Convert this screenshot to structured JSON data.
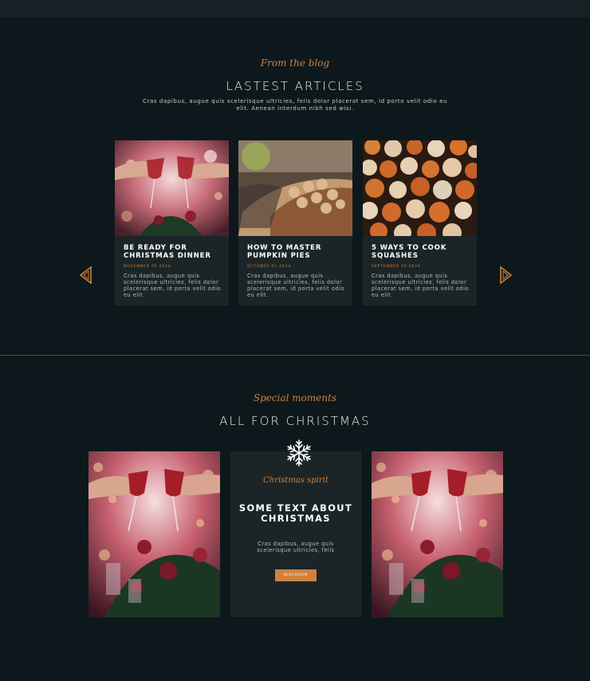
{
  "blog": {
    "script": "From the blog",
    "heading": "LASTEST ARTICLES",
    "sub": "Cras dapibus, augue quis scelerisque ultricies, felis dolor placerat sem, id porto velit odio eu elit. Aenean interdum nibh sed wisi.",
    "cards": [
      {
        "title": "BE READY FOR CHRISTMAS DINNER",
        "date": "NOVEMBER 06 2024",
        "excerpt": "Cras dapibus, augue quis scelerisque ultricies, felis dolor placerat sem, id porta velit odio eu elit."
      },
      {
        "title": "HOW TO MASTER PUMPKIN PIES",
        "date": "OCTOBER 01 2024",
        "excerpt": "Cras dapibus, augue quis scelerisque ultricies, felis dolor placerat sem, id porta velit odio eu elit."
      },
      {
        "title": "5 WAYS TO COOK SQUASHES",
        "date": "SEPTEMBER 15 2024",
        "excerpt": "Cras dapibus, augue quis scelerisque ultricies, felis dolor placerat sem, id porta velit odio eu elit."
      }
    ],
    "prev_icon": "triangle-left-icon",
    "next_icon": "triangle-right-icon"
  },
  "moments": {
    "script": "Special moments",
    "heading": "ALL FOR CHRISTMAS",
    "icon": "snowflake-icon",
    "card": {
      "script": "Christmas spirit",
      "title": "SOME TEXT ABOUT CHRISTMAS",
      "text": "Cras dapibus, augue quis scelerisque ultricies, felis",
      "button": "DISCOVER"
    }
  },
  "colors": {
    "background": "#0d181c",
    "card": "#1b2528",
    "accent": "#d0813d"
  }
}
